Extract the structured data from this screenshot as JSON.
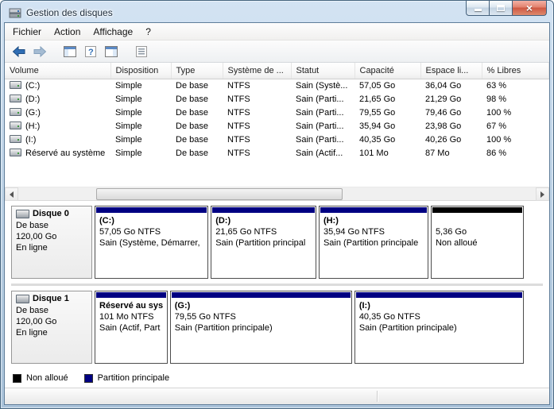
{
  "window": {
    "title": "Gestion des disques"
  },
  "menubar": {
    "items": [
      {
        "label": "Fichier"
      },
      {
        "label": "Action"
      },
      {
        "label": "Affichage"
      },
      {
        "label": "?"
      }
    ]
  },
  "toolbar": {
    "buttons": [
      {
        "icon": "back-icon"
      },
      {
        "icon": "forward-icon"
      },
      {
        "icon": "console-tree-icon"
      },
      {
        "icon": "help-icon"
      },
      {
        "icon": "action-pane-icon"
      },
      {
        "icon": "list-icon"
      }
    ]
  },
  "volume_table": {
    "columns": [
      "Volume",
      "Disposition",
      "Type",
      "Système de ...",
      "Statut",
      "Capacité",
      "Espace li...",
      "% Libres"
    ],
    "rows": [
      {
        "volume": "(C:)",
        "disposition": "Simple",
        "type": "De base",
        "fs": "NTFS",
        "statut": "Sain (Systè...",
        "capacite": "57,05 Go",
        "espace": "36,04 Go",
        "libres": "63 %"
      },
      {
        "volume": "(D:)",
        "disposition": "Simple",
        "type": "De base",
        "fs": "NTFS",
        "statut": "Sain (Parti...",
        "capacite": "21,65 Go",
        "espace": "21,29 Go",
        "libres": "98 %"
      },
      {
        "volume": "(G:)",
        "disposition": "Simple",
        "type": "De base",
        "fs": "NTFS",
        "statut": "Sain (Parti...",
        "capacite": "79,55 Go",
        "espace": "79,46 Go",
        "libres": "100 %"
      },
      {
        "volume": "(H:)",
        "disposition": "Simple",
        "type": "De base",
        "fs": "NTFS",
        "statut": "Sain (Parti...",
        "capacite": "35,94 Go",
        "espace": "23,98 Go",
        "libres": "67 %"
      },
      {
        "volume": "(I:)",
        "disposition": "Simple",
        "type": "De base",
        "fs": "NTFS",
        "statut": "Sain (Parti...",
        "capacite": "40,35 Go",
        "espace": "40,26 Go",
        "libres": "100 %"
      },
      {
        "volume": "Réservé au système",
        "disposition": "Simple",
        "type": "De base",
        "fs": "NTFS",
        "statut": "Sain (Actif...",
        "capacite": "101 Mo",
        "espace": "87 Mo",
        "libres": "86 %"
      }
    ]
  },
  "disks": [
    {
      "name": "Disque 0",
      "type": "De base",
      "size": "120,00 Go",
      "status": "En ligne",
      "partitions": [
        {
          "label": "(C:)",
          "size": "57,05 Go NTFS",
          "status": "Sain (Système, Démarrer,",
          "kind": "primary"
        },
        {
          "label": "(D:)",
          "size": "21,65 Go NTFS",
          "status": "Sain (Partition principal",
          "kind": "primary"
        },
        {
          "label": "(H:)",
          "size": "35,94 Go NTFS",
          "status": "Sain (Partition principale",
          "kind": "primary"
        },
        {
          "label": "",
          "size": "5,36 Go",
          "status": "Non alloué",
          "kind": "unallocated"
        }
      ]
    },
    {
      "name": "Disque 1",
      "type": "De base",
      "size": "120,00 Go",
      "status": "En ligne",
      "partitions": [
        {
          "label": "Réservé au sys",
          "size": "101 Mo NTFS",
          "status": "Sain (Actif, Part",
          "kind": "primary"
        },
        {
          "label": "(G:)",
          "size": "79,55 Go NTFS",
          "status": "Sain (Partition principale)",
          "kind": "primary"
        },
        {
          "label": "(I:)",
          "size": "40,35 Go NTFS",
          "status": "Sain (Partition principale)",
          "kind": "primary"
        }
      ]
    }
  ],
  "legend": [
    {
      "label": "Non alloué",
      "kind": "unallocated"
    },
    {
      "label": "Partition principale",
      "kind": "primary"
    }
  ],
  "colors": {
    "primary": "#000082",
    "unallocated": "#000000"
  }
}
